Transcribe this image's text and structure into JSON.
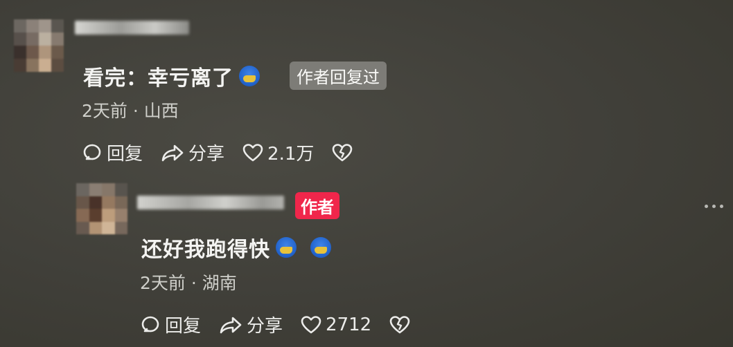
{
  "comment": {
    "text": "看完：幸亏离了",
    "author_replied_label": "作者回复过",
    "time": "2天前",
    "location": "山西",
    "reply_label": "回复",
    "share_label": "分享",
    "likes": "2.1万"
  },
  "reply": {
    "author_badge": "作者",
    "text": "还好我跑得快",
    "time": "2天前",
    "location": "湖南",
    "reply_label": "回复",
    "share_label": "分享",
    "likes": "2712"
  },
  "meta_separator": "·",
  "icons": [
    "comment-icon",
    "share-icon",
    "heart-icon",
    "broken-heart-icon",
    "more-icon",
    "emoji-icon"
  ],
  "colors": {
    "background": "#42413b",
    "author_badge": "#f0264b",
    "replied_tag": "#7d7c77"
  }
}
